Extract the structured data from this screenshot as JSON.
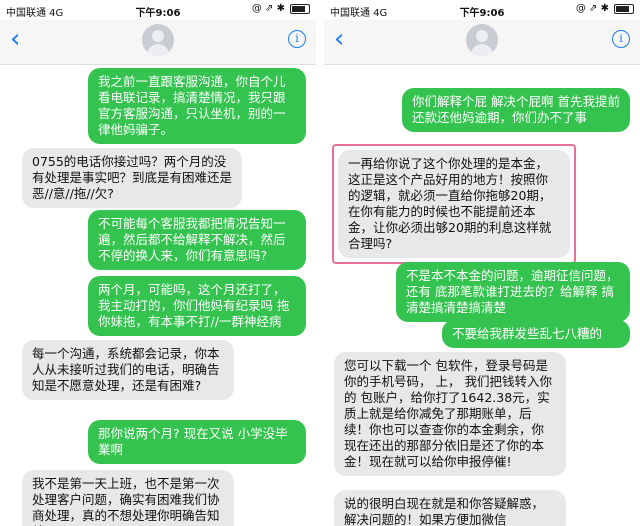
{
  "status_bar": {
    "carrier": "中国联通 4G",
    "time": "下午9:06",
    "icons": "@ ⇗ ✱"
  },
  "nav": {
    "back": "‹",
    "info": "i"
  },
  "left_messages": [
    {
      "type": "sent",
      "text": "我之前一直跟客服沟通，你自个儿看电联记录，搞清楚情况，我只跟官方客服沟通，只认坐机，别的一律他妈骗子。"
    },
    {
      "type": "received",
      "text": "0755的电话你接过吗？两个月的没有处理是事实吧？到底是有困难还是恶//意//拖//欠?"
    },
    {
      "type": "sent",
      "text": "不可能每个客服我都把情况告知一遍，然后都不给解释不解决，然后不停的换人来，你们有意思吗?"
    },
    {
      "type": "sent",
      "text": "两个月，可能吗，这个月还打了，我主动打的，你们他妈有纪录吗 拖你妹拖，有本事不打//一群神经病"
    },
    {
      "type": "received",
      "text": "每一个沟通，系统都会记录，你本人从未接听过我们的电话，明确告知是不愿意处理，还是有困难?"
    },
    {
      "type": "sent",
      "text": "那你说两个月? 现在又说 小学没毕業啊"
    },
    {
      "type": "received",
      "text": "我不是第一天上班，也不是第一次处理客户问题，确实有困难我们协商处理，真的不想处理你明确告知就可以了!"
    }
  ],
  "right_messages": [
    {
      "type": "sent",
      "text": "你们解释个屁 解决个屁啊 首先我提前还款还他妈逾期，你们办不了事"
    },
    {
      "type": "received",
      "text": "一再给你说了这个你处理的是本金，这正是这个产品好用的地方！按照你的逻辑，就必须一直给你拖够20期，在你有能力的时候也不能提前还本金，让你必须出够20期的利息这样就合理吗?"
    },
    {
      "type": "sent",
      "text": "不是本不本金的问题，逾期征信问题，还有 底那笔款谁打进去的？给解释 搞清楚搞清楚搞清楚"
    },
    {
      "type": "sent",
      "text": "不要给我群发些乱七八糟的"
    },
    {
      "type": "received",
      "text": "您可以下载一个 包软件，登录号码是你的手机号码， 上， 我们把钱转入你的 包账户，给你打了1642.38元，实质上就是给你减免了那期账单，后续！你也可以查查你的本金剩余，你现在还出的那部分依旧是还了你的本金！现在就可以给你申报停催!"
    },
    {
      "type": "received",
      "text": "说的很明白现在就是和你答疑解惑，解决问题的！如果方便加微信"
    }
  ]
}
